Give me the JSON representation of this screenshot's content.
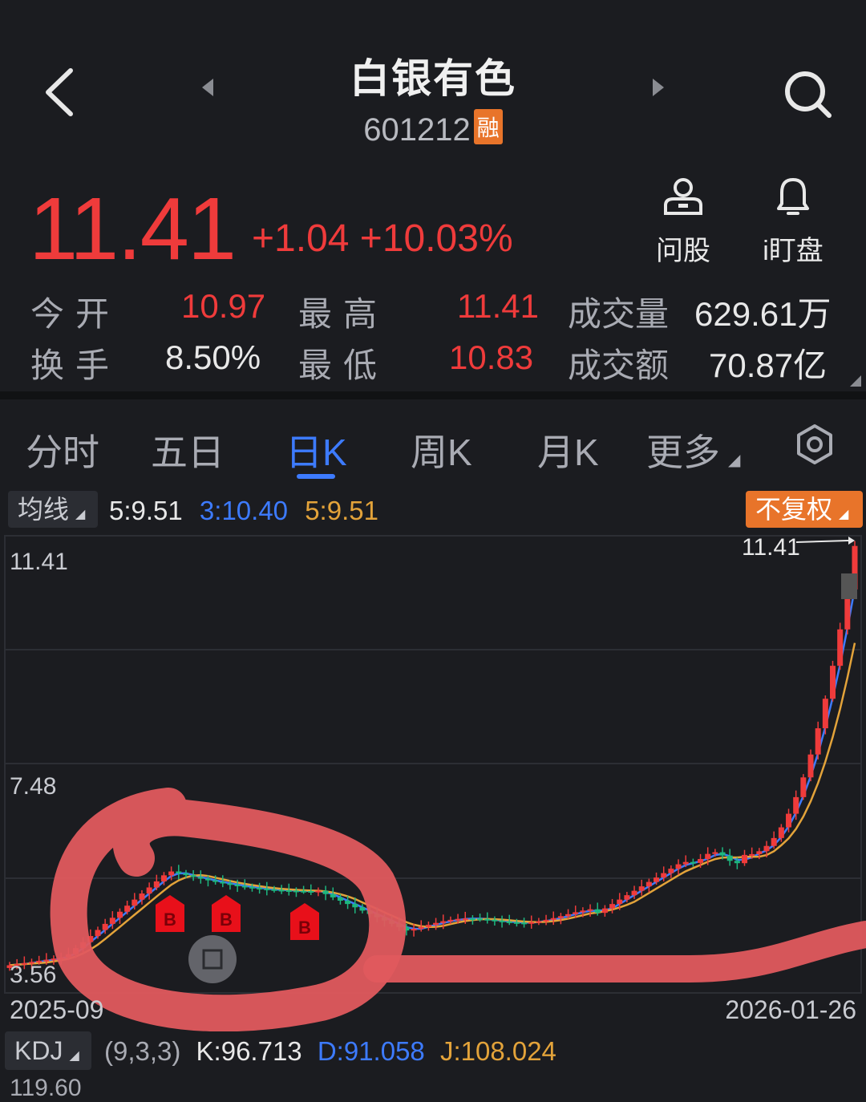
{
  "header": {
    "title": "白银有色",
    "code": "601212",
    "margin_badge": "融"
  },
  "quote": {
    "price": "11.41",
    "change": "+1.04 +10.03%",
    "ask_label": "问股",
    "alert_label": "i盯盘",
    "open_label": "今开",
    "open": "10.97",
    "high_label": "最高",
    "high": "11.41",
    "volume_label": "成交量",
    "volume": "629.61万",
    "turnover_label": "换手",
    "turnover": "8.50%",
    "low_label": "最低",
    "low": "10.83",
    "amount_label": "成交额",
    "amount": "70.87亿"
  },
  "tabs": [
    "分时",
    "五日",
    "日K",
    "周K",
    "月K",
    "更多"
  ],
  "active_tab": "日K",
  "ma": {
    "tag": "均线",
    "ma5": "5:9.51",
    "ma3": "3:10.40",
    "ma5b": "5:9.51",
    "adjust_button": "不复权"
  },
  "chart_data": {
    "type": "candlestick",
    "y_labels": [
      "11.41",
      "7.48",
      "3.56"
    ],
    "x_labels": [
      "2025-09",
      "2026-01-26"
    ],
    "last_price_marker": "11.41",
    "buy_marker": "B",
    "colors": {
      "up": "#ef3b3b",
      "down": "#1db77f",
      "ma_a": "#3d7bff",
      "ma_b": "#e3a33a"
    }
  },
  "kdj": {
    "tag": "KDJ",
    "params": "(9,3,3)",
    "k": "K:96.713",
    "d": "D:91.058",
    "j": "J:108.024",
    "top_value": "119.60"
  }
}
